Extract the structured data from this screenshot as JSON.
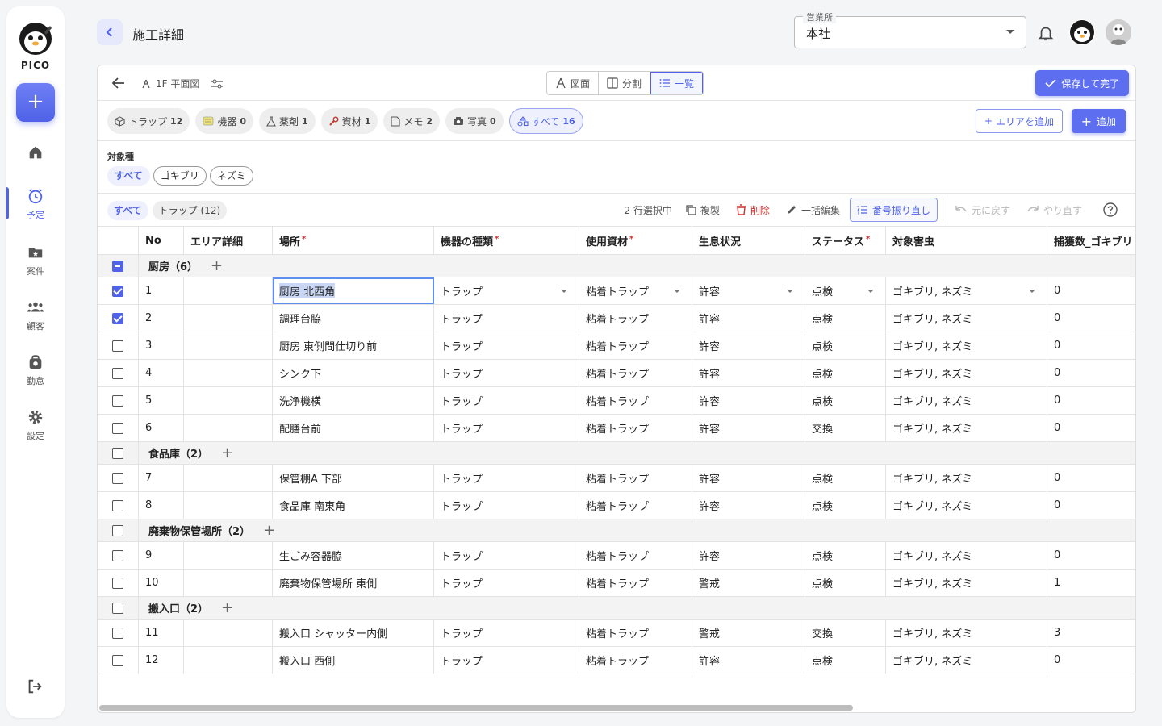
{
  "app": {
    "name": "PICO"
  },
  "sidebar": {
    "items": [
      {
        "label": "",
        "icon": "home-icon"
      },
      {
        "label": "予定",
        "icon": "alarm-clock-icon",
        "active": true
      },
      {
        "label": "案件",
        "icon": "folder-star-icon"
      },
      {
        "label": "顧客",
        "icon": "people-icon"
      },
      {
        "label": "勤怠",
        "icon": "bag-icon"
      },
      {
        "label": "設定",
        "icon": "gear-icon"
      }
    ]
  },
  "header": {
    "title": "施工詳細",
    "office_label": "営業所",
    "office_value": "本社"
  },
  "toolbar": {
    "floor": "1F 平面図",
    "views": [
      "図面",
      "分割",
      "一覧"
    ],
    "save": "保存して完了"
  },
  "filters": {
    "chips": [
      {
        "label": "トラップ",
        "count": "12",
        "icon": "cube-icon"
      },
      {
        "label": "機器",
        "count": "0",
        "icon": "device-icon"
      },
      {
        "label": "薬剤",
        "count": "1",
        "icon": "flask-icon"
      },
      {
        "label": "資材",
        "count": "1",
        "icon": "wrench-icon"
      },
      {
        "label": "メモ",
        "count": "2",
        "icon": "memo-icon"
      },
      {
        "label": "写真",
        "count": "0",
        "icon": "camera-icon"
      },
      {
        "label": "すべて",
        "count": "16",
        "icon": "shapes-icon",
        "active": true
      }
    ],
    "add_area": "エリアを追加",
    "add": "追加"
  },
  "target": {
    "label": "対象種",
    "chips": [
      "すべて",
      "ゴキブリ",
      "ネズミ"
    ]
  },
  "grouping": {
    "chips": [
      "すべて",
      "トラップ (12)"
    ]
  },
  "actions": {
    "selected": "2 行選択中",
    "copy": "複製",
    "delete": "削除",
    "bulk_edit": "一括編集",
    "renumber": "番号振り直し",
    "undo": "元に戻す",
    "redo": "やり直す"
  },
  "table": {
    "columns": [
      "No",
      "エリア詳細",
      "場所",
      "機器の種類",
      "使用資材",
      "生息状況",
      "ステータス",
      "対象害虫",
      "捕獲数_ゴキブリ"
    ],
    "required": [
      false,
      false,
      true,
      true,
      true,
      false,
      true,
      false,
      false
    ],
    "groups": [
      {
        "name": "厨房（6）",
        "rows": [
          {
            "no": "1",
            "area": "",
            "place": "厨房 北西角",
            "type": "トラップ",
            "material": "粘着トラップ",
            "habitat": "許容",
            "status": "点検",
            "pest": "ゴキブリ, ネズミ",
            "count": "0",
            "checked": true,
            "editing": true
          },
          {
            "no": "2",
            "area": "",
            "place": "調理台脇",
            "type": "トラップ",
            "material": "粘着トラップ",
            "habitat": "許容",
            "status": "点検",
            "pest": "ゴキブリ, ネズミ",
            "count": "0",
            "checked": true
          },
          {
            "no": "3",
            "area": "",
            "place": "厨房 東側間仕切り前",
            "type": "トラップ",
            "material": "粘着トラップ",
            "habitat": "許容",
            "status": "点検",
            "pest": "ゴキブリ, ネズミ",
            "count": "0"
          },
          {
            "no": "4",
            "area": "",
            "place": "シンク下",
            "type": "トラップ",
            "material": "粘着トラップ",
            "habitat": "許容",
            "status": "点検",
            "pest": "ゴキブリ, ネズミ",
            "count": "0"
          },
          {
            "no": "5",
            "area": "",
            "place": "洗浄機横",
            "type": "トラップ",
            "material": "粘着トラップ",
            "habitat": "許容",
            "status": "点検",
            "pest": "ゴキブリ, ネズミ",
            "count": "0"
          },
          {
            "no": "6",
            "area": "",
            "place": "配膳台前",
            "type": "トラップ",
            "material": "粘着トラップ",
            "habitat": "許容",
            "status": "交換",
            "pest": "ゴキブリ, ネズミ",
            "count": "0"
          }
        ]
      },
      {
        "name": "食品庫（2）",
        "rows": [
          {
            "no": "7",
            "area": "",
            "place": "保管棚A 下部",
            "type": "トラップ",
            "material": "粘着トラップ",
            "habitat": "許容",
            "status": "点検",
            "pest": "ゴキブリ, ネズミ",
            "count": "0"
          },
          {
            "no": "8",
            "area": "",
            "place": "食品庫 南東角",
            "type": "トラップ",
            "material": "粘着トラップ",
            "habitat": "許容",
            "status": "点検",
            "pest": "ゴキブリ, ネズミ",
            "count": "0"
          }
        ]
      },
      {
        "name": "廃棄物保管場所（2）",
        "rows": [
          {
            "no": "9",
            "area": "",
            "place": "生ごみ容器脇",
            "type": "トラップ",
            "material": "粘着トラップ",
            "habitat": "許容",
            "status": "点検",
            "pest": "ゴキブリ, ネズミ",
            "count": "0"
          },
          {
            "no": "10",
            "area": "",
            "place": "廃棄物保管場所 東側",
            "type": "トラップ",
            "material": "粘着トラップ",
            "habitat": "警戒",
            "status": "点検",
            "pest": "ゴキブリ, ネズミ",
            "count": "1"
          }
        ]
      },
      {
        "name": "搬入口（2）",
        "rows": [
          {
            "no": "11",
            "area": "",
            "place": "搬入口 シャッター内側",
            "type": "トラップ",
            "material": "粘着トラップ",
            "habitat": "警戒",
            "status": "交換",
            "pest": "ゴキブリ, ネズミ",
            "count": "3"
          },
          {
            "no": "12",
            "area": "",
            "place": "搬入口 西側",
            "type": "トラップ",
            "material": "粘着トラップ",
            "habitat": "許容",
            "status": "点検",
            "pest": "ゴキブリ, ネズミ",
            "count": "0"
          }
        ]
      }
    ]
  }
}
